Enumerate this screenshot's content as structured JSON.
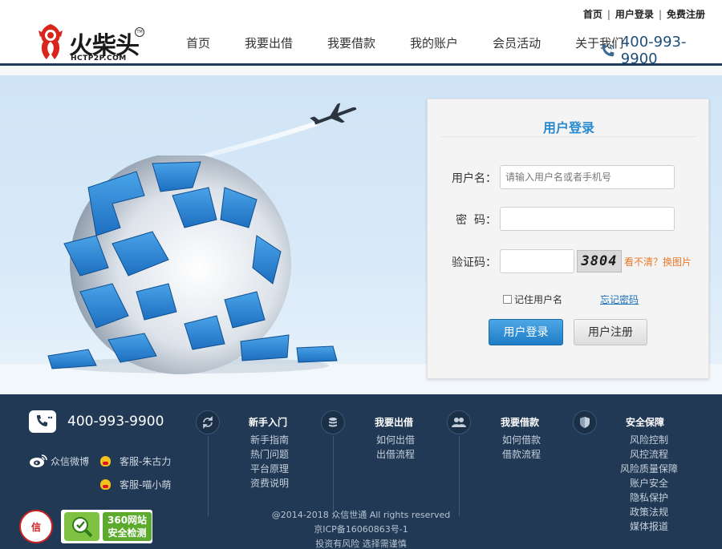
{
  "toplinks": {
    "home": "首页",
    "login": "用户登录",
    "register": "免费注册",
    "sep": "|"
  },
  "logo": {
    "text": "火柴头",
    "sub": "HCTP2P.COM",
    "tm": "TM"
  },
  "nav": {
    "items": [
      {
        "label": "首页"
      },
      {
        "label": "我要出借"
      },
      {
        "label": "我要借款"
      },
      {
        "label": "我的账户"
      },
      {
        "label": "会员活动"
      },
      {
        "label": "关于我们"
      }
    ],
    "phone": "400-993-9900"
  },
  "login": {
    "title": "用户登录",
    "username_label": "用户名：",
    "username_placeholder": "请输入用户名或者手机号",
    "password_label": "密  码：",
    "captcha_label": "验证码：",
    "captcha_text": "3804",
    "refresh_text": "看不清？换图片",
    "remember_label": "记住用户名",
    "forgot_label": "忘记密码",
    "login_button": "用户登录",
    "register_button": "用户注册"
  },
  "footer": {
    "phone": "400-993-9900",
    "weibo": "众信微博",
    "kefu1": "客服-朱古力",
    "kefu2": "客服-喵小萌",
    "columns": [
      {
        "title": "新手入门",
        "links": [
          "新手指南",
          "热门问题",
          "平台原理",
          "资费说明"
        ]
      },
      {
        "title": "我要出借",
        "links": [
          "如何出借",
          "出借流程"
        ]
      },
      {
        "title": "我要借款",
        "links": [
          "如何借款",
          "借款流程"
        ]
      },
      {
        "title": "安全保障",
        "links": [
          "风险控制",
          "风控流程",
          "风险质量保障",
          "账户安全",
          "隐私保护",
          "政策法规",
          "媒体报道"
        ]
      }
    ],
    "copyright": "@2014-2018 众信世通 All rights reserved",
    "icp": "京ICP备16060863号-1",
    "risk": "投资有风险 选择需谨慎",
    "badge_trust": "信",
    "badge_360_line1": "360网站",
    "badge_360_line2": "安全检测"
  },
  "colors": {
    "accent": "#2a8ad0",
    "footer_bg": "#213954",
    "orange": "#e8792a"
  }
}
